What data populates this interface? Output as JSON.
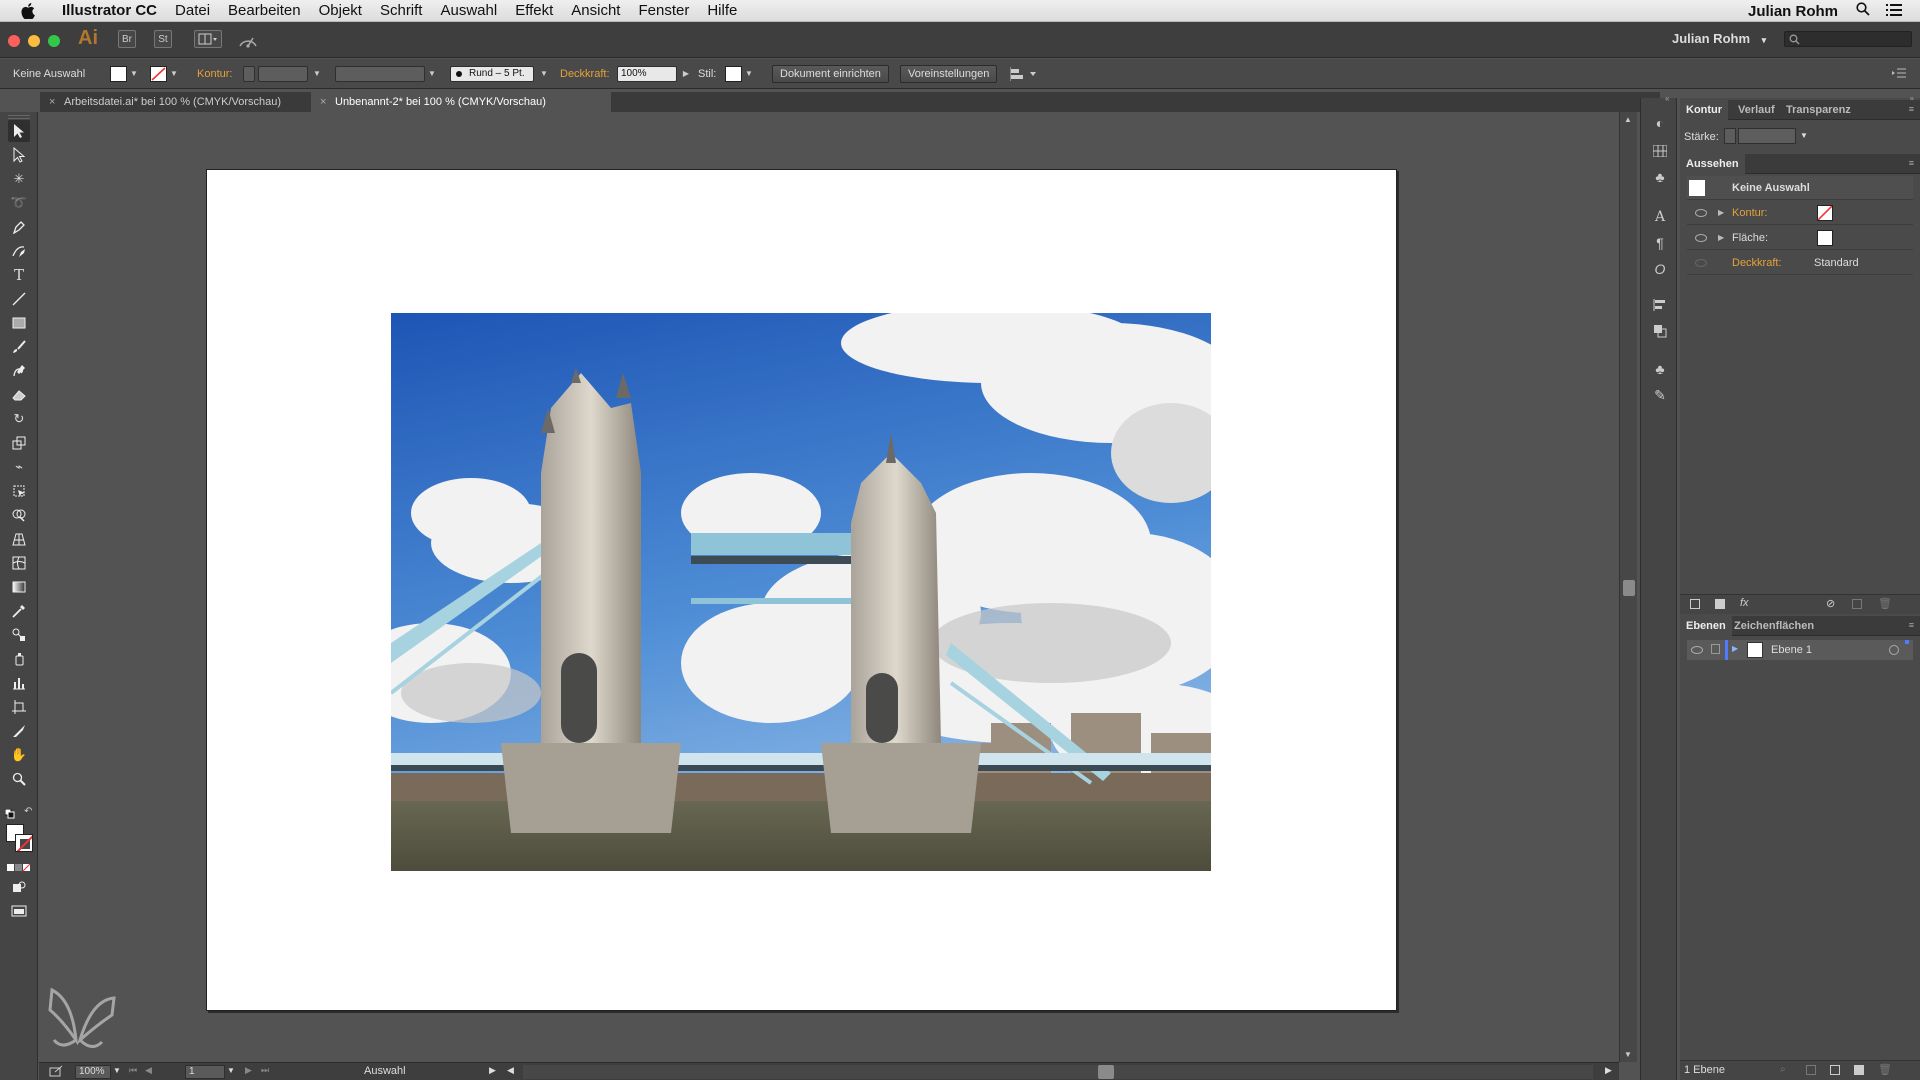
{
  "menubar": {
    "app_name": "Illustrator CC",
    "items": [
      "Datei",
      "Bearbeiten",
      "Objekt",
      "Schrift",
      "Auswahl",
      "Effekt",
      "Ansicht",
      "Fenster",
      "Hilfe"
    ],
    "user": "Julian Rohm"
  },
  "titlebar": {
    "logo": "Ai",
    "bridge_label": "Br",
    "stock_label": "St",
    "workspace_user": "Julian Rohm"
  },
  "control_bar": {
    "selection_label": "Keine Auswahl",
    "stroke_label": "Kontur:",
    "brush_label": "Rund – 5 Pt.",
    "opacity_label": "Deckkraft:",
    "opacity_value": "100%",
    "style_label": "Stil:",
    "doc_setup_button": "Dokument einrichten",
    "preferences_button": "Voreinstellungen"
  },
  "document_tabs": [
    {
      "label": "Arbeitsdatei.ai* bei 100 % (CMYK/Vorschau)",
      "active": false
    },
    {
      "label": "Unbenannt-2* bei 100 % (CMYK/Vorschau)",
      "active": true
    }
  ],
  "status_bar": {
    "zoom": "100%",
    "artboard_number": "1",
    "tool_label": "Auswahl"
  },
  "kontur_panel": {
    "tabs": [
      "Kontur",
      "Verlauf",
      "Transparenz"
    ],
    "weight_label": "Stärke:"
  },
  "aussehen_panel": {
    "title": "Aussehen",
    "header": "Keine Auswahl",
    "rows": [
      {
        "label": "Kontur:",
        "value": ""
      },
      {
        "label": "Fläche:",
        "value": ""
      },
      {
        "label": "Deckkraft:",
        "value": "Standard"
      }
    ]
  },
  "ebenen_panel": {
    "tabs": [
      "Ebenen",
      "Zeichenflächen"
    ],
    "layers": [
      {
        "name": "Ebene 1"
      }
    ],
    "footer": "1 Ebene"
  },
  "colors": {
    "accent_orange": "#e5a23b",
    "ui_dark": "#454545",
    "canvas": "#535353"
  }
}
